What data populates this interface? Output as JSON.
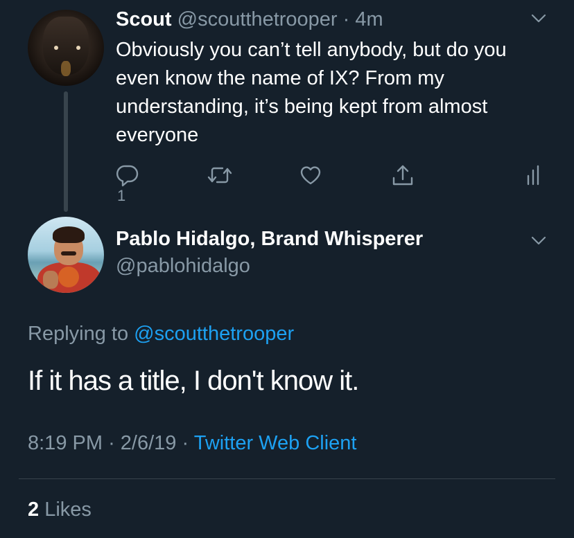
{
  "parent_tweet": {
    "display_name": "Scout",
    "handle": "@scoutthetrooper",
    "separator": "·",
    "time": "4m",
    "text": "Obviously you can’t tell anybody, but do you even know the name of IX? From my understanding, it’s being kept from almost everyone",
    "actions": {
      "reply_icon": "reply-icon",
      "reply_count": "1",
      "retweet_icon": "retweet-icon",
      "like_icon": "heart-icon",
      "share_icon": "share-icon",
      "analytics_icon": "analytics-icon"
    },
    "menu_icon": "chevron-down-icon"
  },
  "reply_tweet": {
    "display_name": "Pablo Hidalgo, Brand Whisperer",
    "handle": "@pablohidalgo",
    "menu_icon": "chevron-down-icon",
    "replying_prefix": "Replying to",
    "replying_to": "@scoutthetrooper",
    "text": "If it has a title, I don't know it.",
    "time": "8:19 PM",
    "separator": "·",
    "date": "2/6/19",
    "client": "Twitter Web Client",
    "likes_count": "2",
    "likes_label": "Likes"
  },
  "colors": {
    "background": "#15202b",
    "text_primary": "#ffffff",
    "text_secondary": "#8899a6",
    "link": "#1da1f2",
    "divider": "#38444d"
  }
}
